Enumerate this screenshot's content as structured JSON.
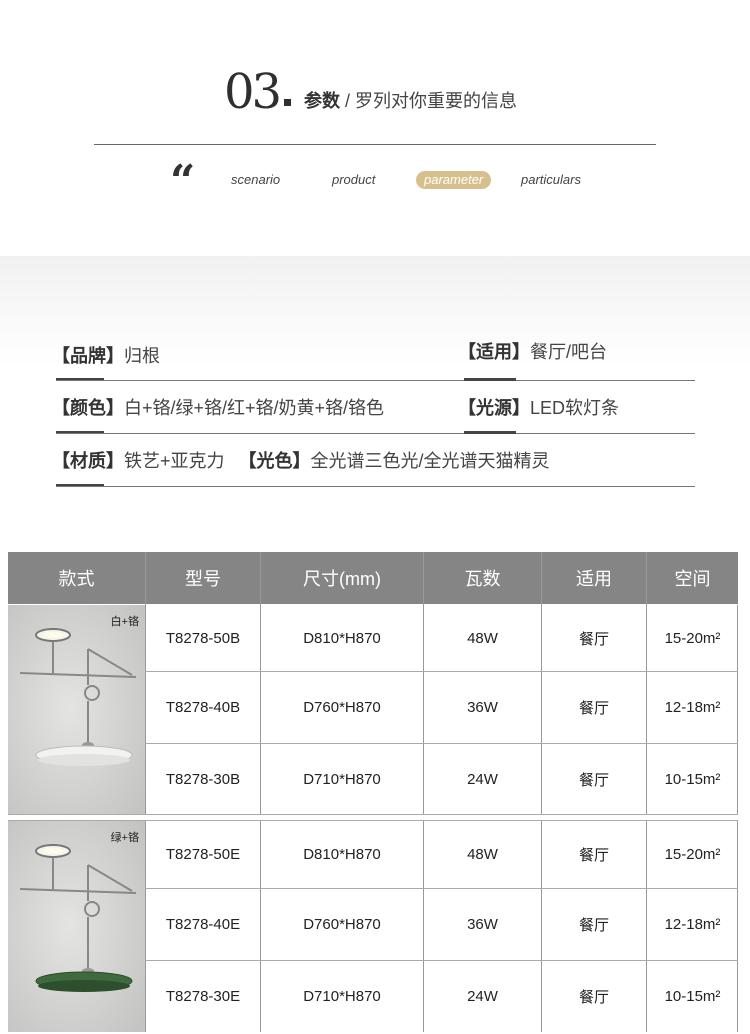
{
  "header": {
    "number": "03",
    "title_bold": "参数",
    "title_rest": " / 罗列对你重要的信息",
    "tabs": [
      {
        "label": "scenario",
        "active": false
      },
      {
        "label": "product",
        "active": false
      },
      {
        "label": "parameter",
        "active": true
      },
      {
        "label": "particulars",
        "active": false
      }
    ],
    "quote_glyph": "“"
  },
  "specs": {
    "brand_key": "【品牌】",
    "brand_val": "归根",
    "use_key": "【适用】",
    "use_val": "餐厅/吧台",
    "color_key": "【颜色】",
    "color_val": "白+铬/绿+铬/红+铬/奶黄+铬/铬色",
    "light_key": "【光源】",
    "light_val": "LED软灯条",
    "material_key": "【材质】",
    "material_val": "铁艺+亚克力",
    "lightcolor_key": "【光色】",
    "lightcolor_val": "全光谱三色光/全光谱天猫精灵"
  },
  "table": {
    "headers": [
      "款式",
      "型号",
      "尺寸(mm)",
      "瓦数",
      "适用",
      "空间"
    ],
    "groups": [
      {
        "color_label": "白+铬",
        "shade_color": "#e8e8e6",
        "rows": [
          {
            "model": "T8278-50B",
            "size": "D810*H870",
            "watt": "48W",
            "use": "餐厅",
            "space": "15-20m²"
          },
          {
            "model": "T8278-40B",
            "size": "D760*H870",
            "watt": "36W",
            "use": "餐厅",
            "space": "12-18m²"
          },
          {
            "model": "T8278-30B",
            "size": "D710*H870",
            "watt": "24W",
            "use": "餐厅",
            "space": "10-15m²"
          }
        ]
      },
      {
        "color_label": "绿+铬",
        "shade_color": "#3f6a3e",
        "rows": [
          {
            "model": "T8278-50E",
            "size": "D810*H870",
            "watt": "48W",
            "use": "餐厅",
            "space": "15-20m²"
          },
          {
            "model": "T8278-40E",
            "size": "D760*H870",
            "watt": "36W",
            "use": "餐厅",
            "space": "12-18m²"
          },
          {
            "model": "T8278-30E",
            "size": "D710*H870",
            "watt": "24W",
            "use": "餐厅",
            "space": "10-15m²"
          }
        ]
      }
    ]
  }
}
